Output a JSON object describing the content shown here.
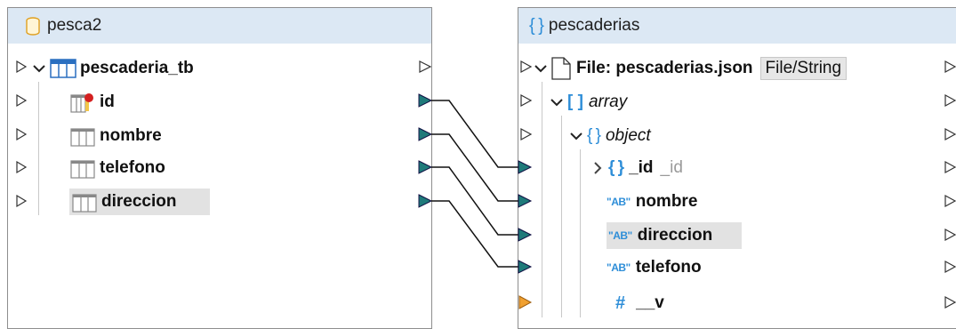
{
  "source": {
    "title": "pesca2",
    "table": "pescaderia_tb",
    "columns": [
      {
        "name": "id",
        "key": true
      },
      {
        "name": "nombre"
      },
      {
        "name": "telefono"
      },
      {
        "name": "direccion",
        "selected": true
      }
    ]
  },
  "target": {
    "title": "pescaderias",
    "file_label": "File: pescaderias.json",
    "file_button": "File/String",
    "array_label": "array",
    "object_label": "object",
    "fields": [
      {
        "name": "_id",
        "alt": "_id",
        "type": "object"
      },
      {
        "name": "nombre",
        "type": "string"
      },
      {
        "name": "direccion",
        "type": "string",
        "selected": true
      },
      {
        "name": "telefono",
        "type": "string"
      },
      {
        "name": "__v",
        "type": "number"
      }
    ],
    "string_icon": "\"AB\"",
    "number_icon": "#",
    "object_icon": "{ }",
    "array_icon": "[ ]"
  },
  "colors": {
    "header_bg": "#dce8f4",
    "connector_mapped": "#1f7a7a",
    "connector_unmapped": "#ffffff",
    "connector_warning": "#f0a030",
    "accent": "#2e8ed8"
  },
  "mappings": [
    {
      "from": "id",
      "to": "_id"
    },
    {
      "from": "nombre",
      "to": "nombre"
    },
    {
      "from": "telefono",
      "to": "direccion"
    },
    {
      "from": "direccion",
      "to": "telefono"
    }
  ]
}
